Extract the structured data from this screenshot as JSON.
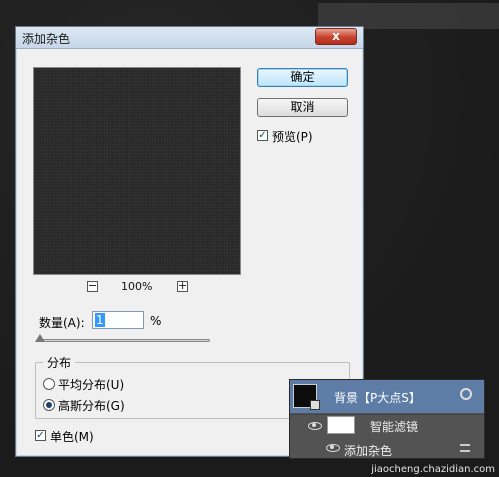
{
  "dialog": {
    "title": "添加杂色",
    "close_label": "x",
    "zoom": {
      "minus": "−",
      "level": "100%",
      "plus": "+"
    },
    "buttons": {
      "ok": "确定",
      "cancel": "取消"
    },
    "preview": {
      "label": "预览(P)",
      "checked": true,
      "check_mark": "✓"
    },
    "amount": {
      "label": "数量(A):",
      "value": "1",
      "unit": "%"
    },
    "distribution": {
      "title": "分布",
      "options": [
        {
          "label": "平均分布(U)",
          "selected": false
        },
        {
          "label": "高斯分布(G)",
          "selected": true
        }
      ]
    },
    "monochromatic": {
      "label": "单色(M)",
      "checked": true,
      "check_mark": "✓"
    }
  },
  "layers_panel": {
    "layer_name": "背景【P大点S】",
    "smart_filter_label": "智能滤镜",
    "filter_label": "添加杂色"
  },
  "watermark": "jiaocheng.chazidian.com"
}
